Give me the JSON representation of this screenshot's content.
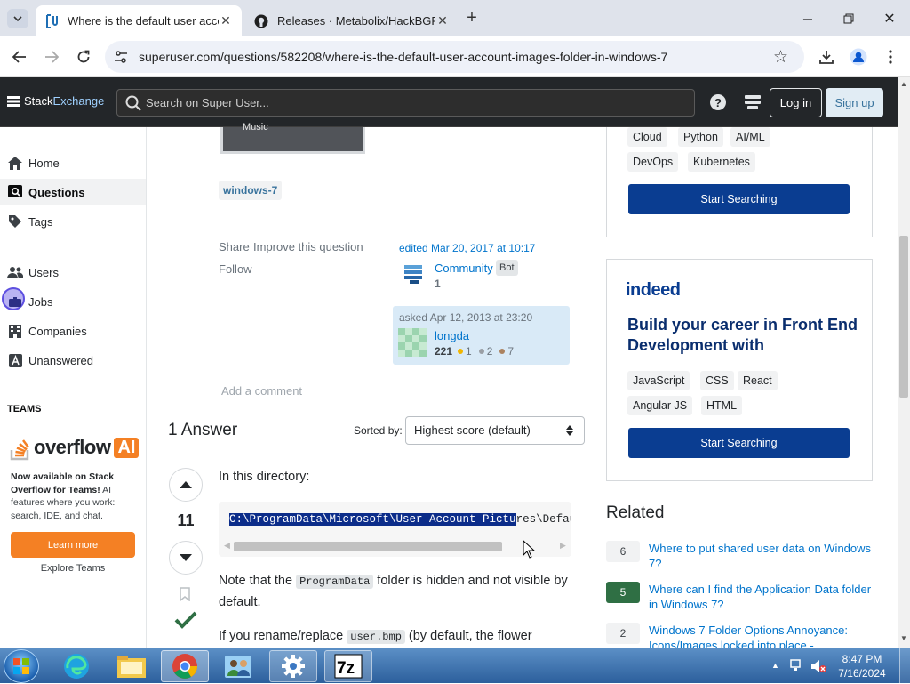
{
  "browser": {
    "tabs": [
      {
        "title": "Where is the default user accou",
        "active": true
      },
      {
        "title": "Releases · Metabolix/HackBGRT",
        "active": false
      }
    ],
    "url": "superuser.com/questions/582208/where-is-the-default-user-account-images-folder-in-windows-7"
  },
  "topbar": {
    "logo_a": "Stack",
    "logo_b": "Exchange",
    "search_placeholder": "Search on Super User...",
    "login": "Log in",
    "signup": "Sign up"
  },
  "nav": {
    "home": "Home",
    "questions": "Questions",
    "tags": "Tags",
    "users": "Users",
    "jobs": "Jobs",
    "companies": "Companies",
    "unanswered": "Unanswered",
    "teams_heading": "TEAMS",
    "overflow_brand": "overflow",
    "overflow_ai": "AI",
    "teams_promo_bold": "Now available on Stack Overflow for Teams!",
    "teams_promo_rest": " AI features where you work: search, IDE, and chat.",
    "learn_more": "Learn more",
    "explore_teams": "Explore Teams"
  },
  "question": {
    "image_caption": "Music",
    "tag": "windows-7",
    "share": "Share",
    "improve": "Improve this question",
    "follow": "Follow",
    "edited": "edited Mar 20, 2017 at 10:17",
    "editor_name": "Community",
    "editor_badge": "Bot",
    "editor_rep": "1",
    "asked": "asked Apr 12, 2013 at 23:20",
    "asker_name": "longda",
    "asker_rep": "221",
    "gold": "1",
    "silver": "2",
    "bronze": "7",
    "add_comment": "Add a comment"
  },
  "answers": {
    "count_label": "1 Answer",
    "sorted_by": "Sorted by:",
    "sort_value": "Highest score (default)",
    "score": "11",
    "intro": "In this directory:",
    "code_selected": "C:\\ProgramData\\Microsoft\\User Account Pictu",
    "code_rest": "res\\Default",
    "note_a": "Note that the ",
    "note_code": "ProgramData",
    "note_b": " folder is hidden and not visible by default.",
    "rename_a": "If you rename/replace ",
    "rename_code": "user.bmp",
    "rename_b": " (by default, the flower"
  },
  "sidebar": {
    "tags1": [
      "Cloud",
      "Python",
      "AI/ML",
      "DevOps",
      "Kubernetes"
    ],
    "start_searching_1": "Start Searching",
    "indeed_logo": "indeed",
    "indeed_headline": "Build your career in Front End Development with",
    "tags2": [
      "JavaScript",
      "CSS",
      "React",
      "Angular JS",
      "HTML"
    ],
    "start_searching_2": "Start Searching",
    "related_heading": "Related",
    "related": [
      {
        "score": "6",
        "title": "Where to put shared user data on Windows 7?",
        "accepted": false
      },
      {
        "score": "5",
        "title": "Where can I find the Application Data folder in Windows 7?",
        "accepted": true
      },
      {
        "score": "2",
        "title": "Windows 7 Folder Options Annoyance: Icons/Images locked into place -",
        "accepted": false
      }
    ]
  },
  "taskbar": {
    "time": "8:47 PM",
    "date": "7/16/2024"
  },
  "colors": {
    "accent": "#0a3d91",
    "accepted": "#2f6f44",
    "selection": "#0c2d8a"
  }
}
